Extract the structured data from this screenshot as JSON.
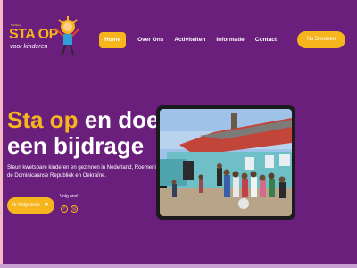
{
  "logo": {
    "small": "Stichting",
    "title": "STA OP",
    "subtitle": "voor kinderen"
  },
  "nav": {
    "items": [
      {
        "label": "Home"
      },
      {
        "label": "Over Ons"
      },
      {
        "label": "Activiteiten"
      },
      {
        "label": "Informatie"
      },
      {
        "label": "Contact"
      }
    ],
    "donate_label": "Nu Doneren"
  },
  "hero": {
    "highlight": "Sta op",
    "rest": "en doe",
    "line2": "een bijdrage",
    "description": "Steun kwetsbare kinderen en gezinnen in Nederland, Roemenië, de Dominicaanse Republiek en Oekraïne.",
    "help_label": "Ik help mee",
    "follow_label": "Volg ons!"
  },
  "social": {
    "facebook": "f",
    "instagram": "◎"
  },
  "colors": {
    "background": "#6b1f7d",
    "accent": "#f6b51c"
  }
}
